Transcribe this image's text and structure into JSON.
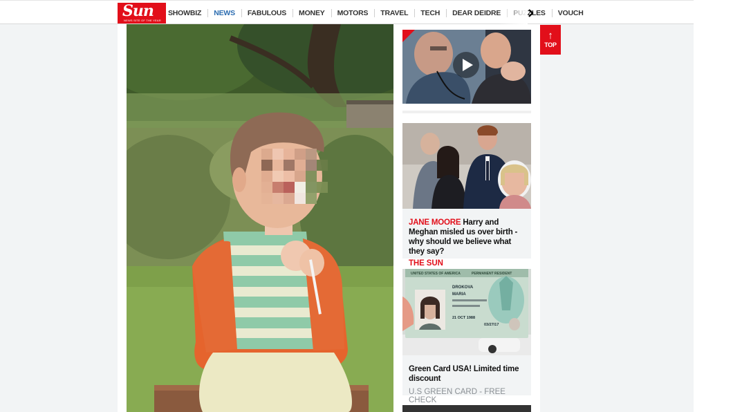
{
  "brand": {
    "logo_the": "THE",
    "logo_name": "Sun",
    "logo_tagline": "NEWS SITE OF THE YEAR"
  },
  "nav": {
    "items": [
      "SHOWBIZ",
      "NEWS",
      "FABULOUS",
      "MONEY",
      "MOTORS",
      "TRAVEL",
      "TECH",
      "DEAR DEIDRE",
      "PUZZLES",
      "VOUCH"
    ],
    "active": "NEWS",
    "more_icon": "chevron-right-icon"
  },
  "sidebar": {
    "video_card": {
      "icon": "play-icon"
    },
    "story": {
      "kicker": "JANE MOORE",
      "headline": " Harry and Meghan misled us over birth - why should we believe what they say?",
      "source": "THE SUN"
    },
    "ad": {
      "headline": "Green Card USA! Limited time discount",
      "source": "U.S GREEN CARD - FREE CHECK",
      "card_texts": [
        "UNITED STATES OF AMERICA",
        "PERMANENT RESIDENT",
        "DROKOVA",
        "MARIA",
        "21 OCT 1988",
        "03/27/17"
      ]
    }
  },
  "top_button": {
    "label": "TOP",
    "icon": "arrow-up-icon"
  },
  "colors": {
    "brand_red": "#e20f1a",
    "nav_active": "#2b6cb0",
    "sidebar_bg": "#f2f4f5",
    "source_grey": "#8a8f94"
  }
}
